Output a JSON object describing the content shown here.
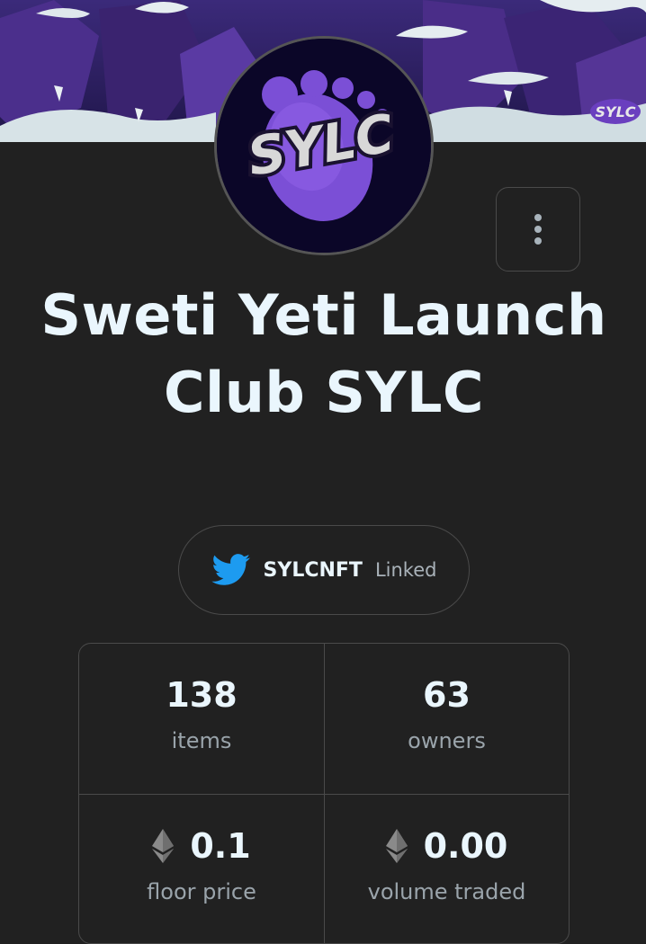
{
  "collection": {
    "name": "Sweti Yeti Launch Club SYLC",
    "avatar_text": "SYLC"
  },
  "twitter": {
    "icon": "twitter-icon",
    "handle": "SYLCNFT",
    "status": "Linked"
  },
  "menu": {
    "icon": "more-vertical-icon"
  },
  "stats": {
    "items_value": "138",
    "items_label": "items",
    "owners_value": "63",
    "owners_label": "owners",
    "floor_value": "0.1",
    "floor_label": "floor price",
    "volume_value": "0.00",
    "volume_label": "volume traded",
    "currency_icon": "ethereum-icon"
  },
  "colors": {
    "background": "#212121",
    "text": "#eaf6fd",
    "muted": "#9aa4ab",
    "twitter": "#1d9bf0",
    "brand_purple": "#6b3fc4"
  }
}
